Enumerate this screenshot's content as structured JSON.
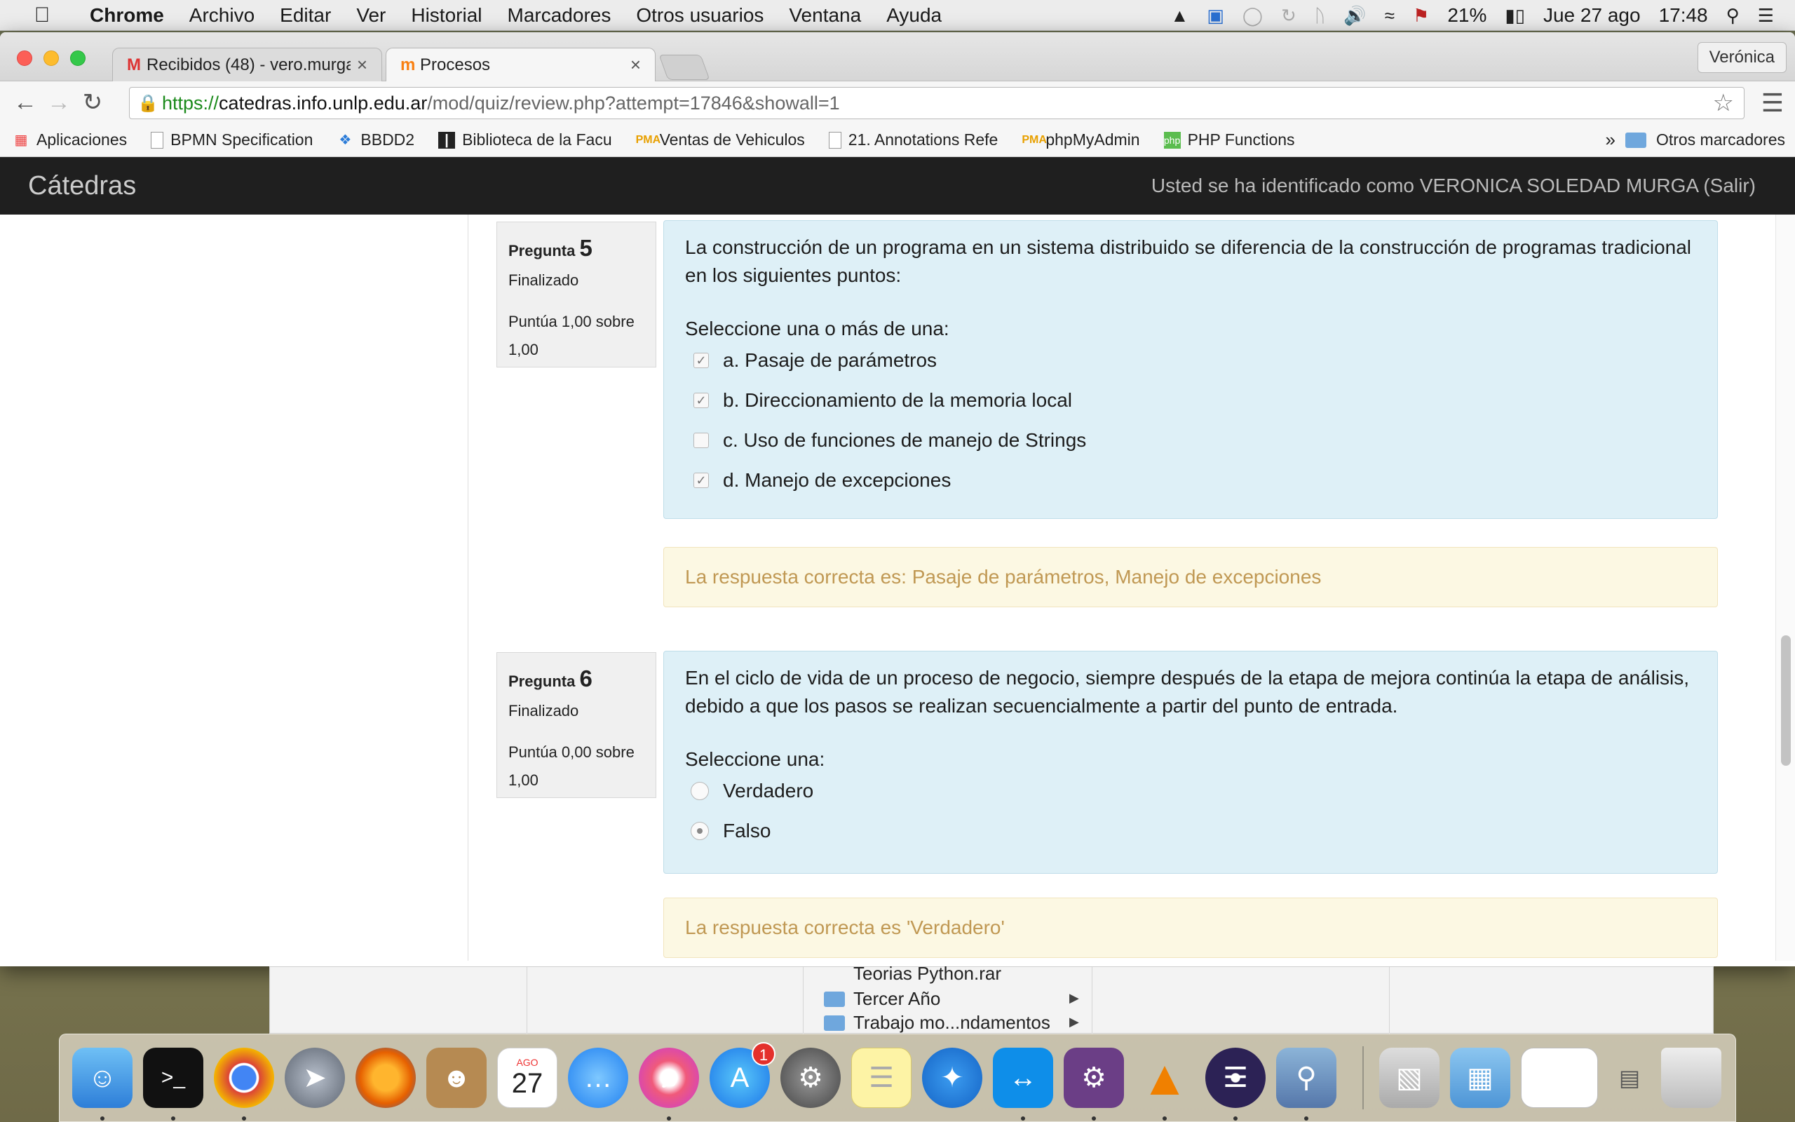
{
  "menubar": {
    "app_name": "Chrome",
    "items": [
      "Archivo",
      "Editar",
      "Ver",
      "Historial",
      "Marcadores",
      "Otros usuarios",
      "Ventana",
      "Ayuda"
    ],
    "battery": "21%",
    "date": "Jue 27 ago",
    "time": "17:48"
  },
  "browser": {
    "profile": "Verónica",
    "tabs": [
      {
        "title": "Recibidos (48) - vero.murga",
        "icon": "gmail-icon",
        "active": false
      },
      {
        "title": "Procesos",
        "icon": "moodle-icon",
        "active": true
      }
    ],
    "url": {
      "scheme": "https://",
      "host": "catedras.info.unlp.edu.ar",
      "path": "/mod/quiz/review.php?attempt=17846&showall=1"
    },
    "bookmarks": [
      {
        "label": "Aplicaciones",
        "icon": "apps-icon"
      },
      {
        "label": "BPMN Specification",
        "icon": "page-icon"
      },
      {
        "label": "BBDD2",
        "icon": "dropbox-icon"
      },
      {
        "label": "Biblioteca de la Facu",
        "icon": "library-icon"
      },
      {
        "label": "Ventas de Vehiculos",
        "icon": "phpmyadmin-icon"
      },
      {
        "label": "21. Annotations Refe",
        "icon": "page-icon"
      },
      {
        "label": "phpMyAdmin",
        "icon": "phpmyadmin-icon"
      },
      {
        "label": "PHP Functions",
        "icon": "php-icon"
      }
    ],
    "bookmarks_overflow": "»",
    "other_bookmarks": "Otros marcadores"
  },
  "site": {
    "brand": "Cátedras",
    "login_info": "Usted se ha identificado como VERONICA SOLEDAD MURGA (Salir)"
  },
  "questions": [
    {
      "label": "Pregunta",
      "number": "5",
      "state": "Finalizado",
      "grade": "Puntúa 1,00 sobre 1,00",
      "text": "La construcción de un programa en un sistema distribuido se diferencia de la construcción de programas tradicional en los siguientes puntos:",
      "prompt": "Seleccione una o más de una:",
      "answers": [
        {
          "label": "a. Pasaje de parámetros",
          "checked": true
        },
        {
          "label": "b. Direccionamiento de la memoria local",
          "checked": true
        },
        {
          "label": "c. Uso de funciones de manejo de Strings",
          "checked": false
        },
        {
          "label": "d. Manejo de excepciones",
          "checked": true
        }
      ],
      "feedback": "La respuesta correcta es: Pasaje de parámetros, Manejo de excepciones"
    },
    {
      "label": "Pregunta",
      "number": "6",
      "state": "Finalizado",
      "grade": "Puntúa 0,00 sobre 1,00",
      "text": "En el ciclo de vida de un proceso de negocio, siempre después de la etapa de  mejora continúa la etapa de análisis, debido a que los pasos se realizan secuencialmente a partir del punto de entrada.",
      "prompt": "Seleccione una:",
      "answers": [
        {
          "label": "Verdadero",
          "checked": false
        },
        {
          "label": "Falso",
          "checked": true
        }
      ],
      "feedback": "La respuesta correcta es 'Verdadero'"
    }
  ],
  "finder": {
    "items": [
      "Teorias Python.rar",
      "Tercer Año",
      "Trabajo mo...ndamentos"
    ]
  },
  "dock": {
    "calendar_month": "AGO",
    "calendar_day": "27",
    "app_store_badge": "1"
  }
}
